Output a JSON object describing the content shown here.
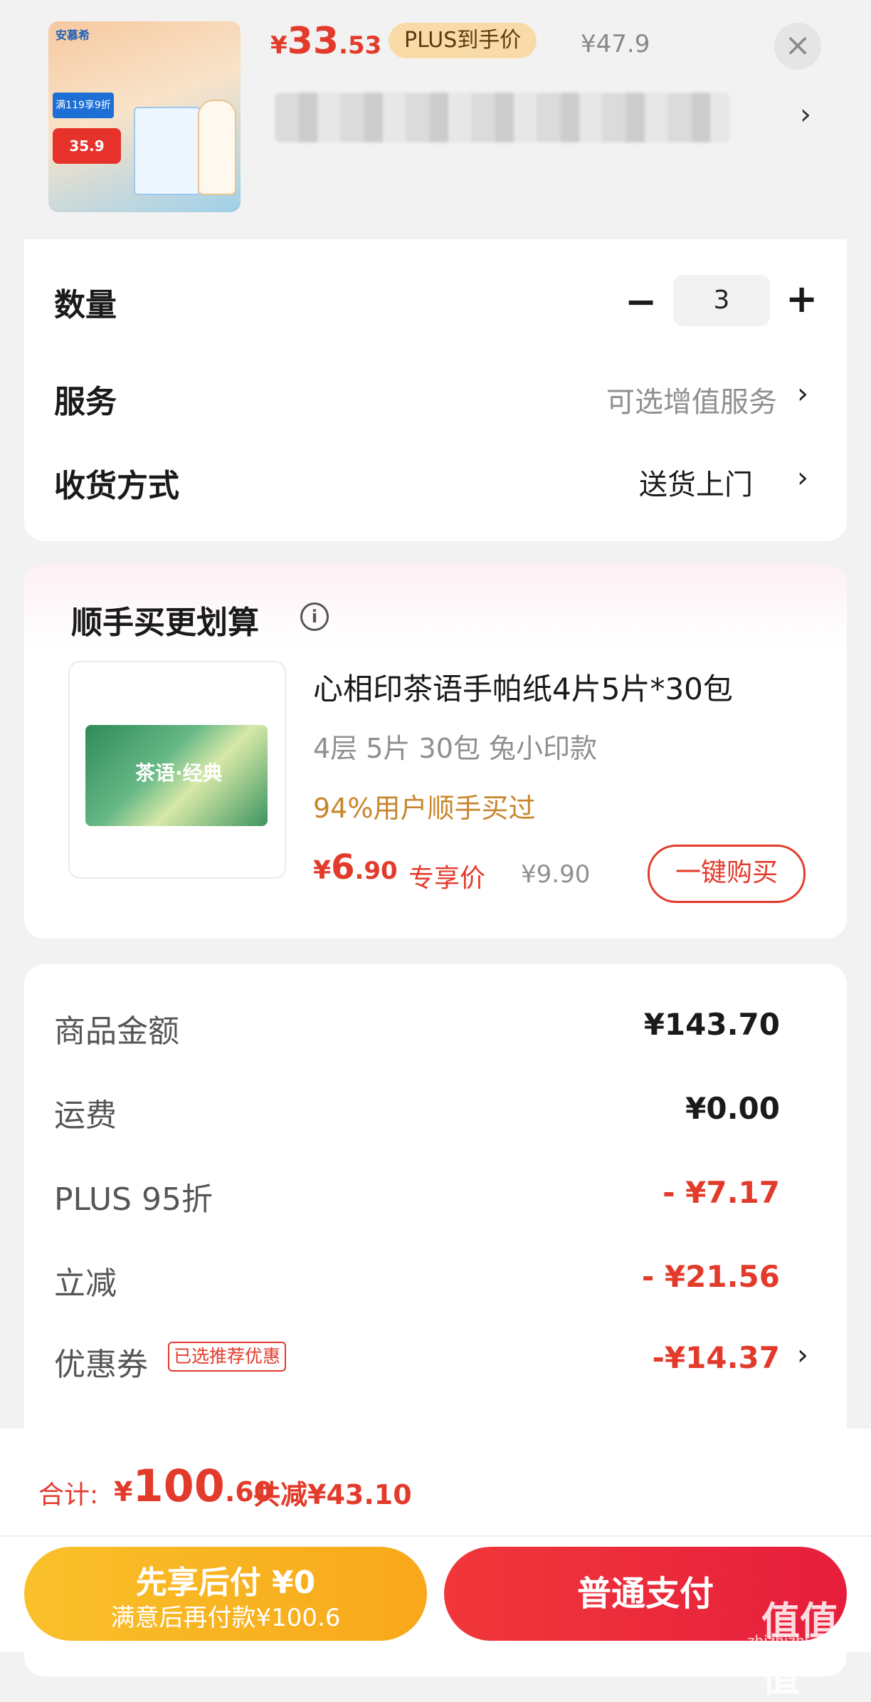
{
  "product": {
    "thumb_brand": "安慕希",
    "thumb_tag1": "满119享9折",
    "thumb_tag2": "35.9",
    "price_symbol": "¥",
    "price_int": "33",
    "price_dec": ".53",
    "plus_badge": "PLUS到手价",
    "original_price": "¥47.9",
    "close_icon": "×",
    "title_chevron": "›"
  },
  "options": {
    "quantity_label": "数量",
    "quantity_minus": "−",
    "quantity_value": "3",
    "quantity_plus": "+",
    "service_label": "服务",
    "service_value": "可选增值服务",
    "delivery_label": "收货方式",
    "delivery_value": "送货上门",
    "chevron": "›"
  },
  "recommend": {
    "title": "顺手买更划算",
    "info_icon": "i",
    "image_text": "茶语·经典",
    "name": "心相印茶语手帕纸4片5片*30包",
    "spec": "4层 5片 30包 兔小印款",
    "bought": "94%用户顺手买过",
    "price_symbol": "¥",
    "price_int": "6",
    "price_dec": ".90",
    "price_tag": "专享价",
    "original_price": "¥9.90",
    "buy_button": "一键购买"
  },
  "summary": {
    "rows": [
      {
        "label": "商品金额",
        "value": "¥143.70"
      },
      {
        "label": "运费",
        "value": "¥0.00"
      },
      {
        "label": "PLUS 95折",
        "value": "- ¥7.17"
      },
      {
        "label": "立减",
        "value": "- ¥21.56"
      },
      {
        "label": "优惠券",
        "value": "-¥14.37"
      }
    ],
    "coupon_badge": "已选推荐优惠"
  },
  "footer": {
    "total_label": "合计:",
    "total_symbol": "¥",
    "total_int": "100",
    "total_dec": ".60",
    "total_saved": "共减¥43.10",
    "pay_later_line1": "先享后付 ¥0",
    "pay_later_line2": "满意后再付款¥100.6",
    "pay_normal": "普通支付"
  },
  "watermark": {
    "text": "值值值",
    "url": "zhizhizhi.com"
  },
  "colors": {
    "accent_red": "#e33b2b",
    "gold": "#c8862c",
    "pay_later_yellow": "#f9c02a"
  }
}
